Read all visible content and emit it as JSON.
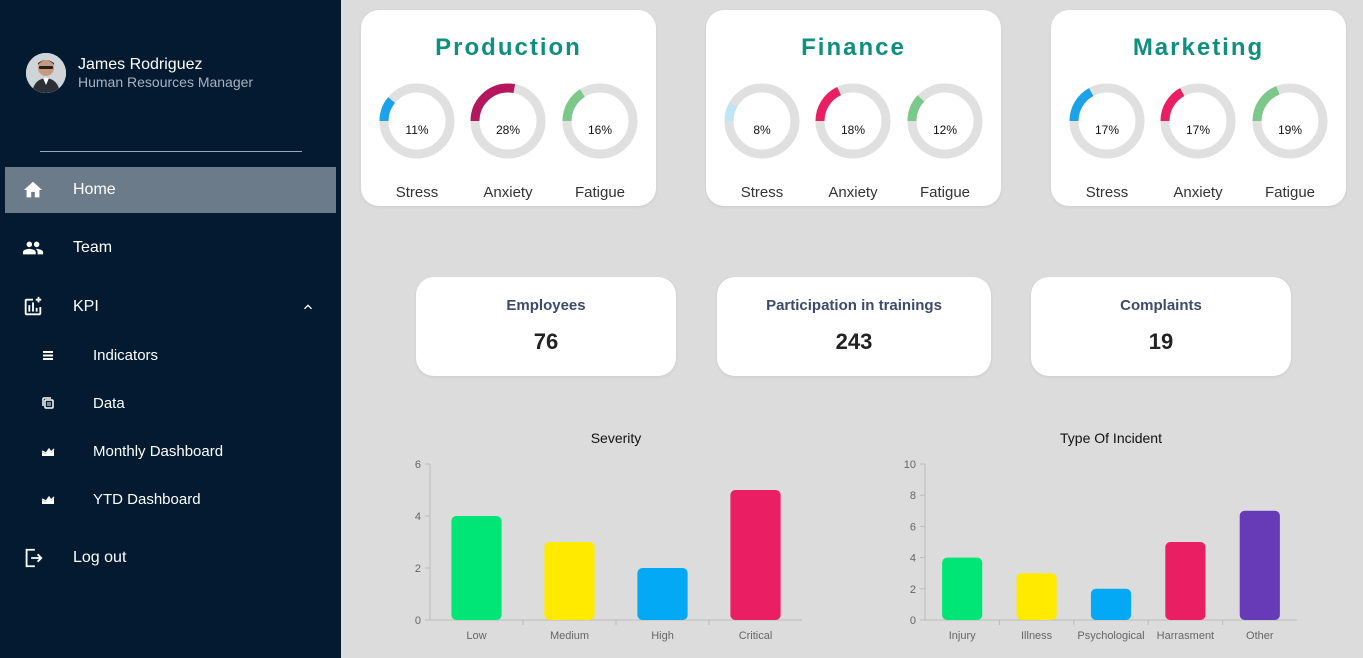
{
  "user": {
    "name": "James Rodriguez",
    "role": "Human Resources Manager"
  },
  "nav": {
    "home": "Home",
    "team": "Team",
    "kpi": "KPI",
    "indicators": "Indicators",
    "data": "Data",
    "monthly": "Monthly Dashboard",
    "ytd": "YTD Dashboard",
    "logout": "Log out"
  },
  "departments": [
    {
      "title": "Production",
      "metrics": [
        {
          "label": "Stress",
          "percent": 11,
          "display": "11%",
          "color": "#1aa3e8"
        },
        {
          "label": "Anxiety",
          "percent": 28,
          "display": "28%",
          "color": "#b5175e"
        },
        {
          "label": "Fatigue",
          "percent": 16,
          "display": "16%",
          "color": "#7cc78a"
        }
      ]
    },
    {
      "title": "Finance",
      "metrics": [
        {
          "label": "Stress",
          "percent": 8,
          "display": "8%",
          "color": "#bfe6f7"
        },
        {
          "label": "Anxiety",
          "percent": 18,
          "display": "18%",
          "color": "#e91e63"
        },
        {
          "label": "Fatigue",
          "percent": 12,
          "display": "12%",
          "color": "#7cc78a"
        }
      ]
    },
    {
      "title": "Marketing",
      "metrics": [
        {
          "label": "Stress",
          "percent": 17,
          "display": "17%",
          "color": "#1aa3e8"
        },
        {
          "label": "Anxiety",
          "percent": 17,
          "display": "17%",
          "color": "#e91e63"
        },
        {
          "label": "Fatigue",
          "percent": 19,
          "display": "19%",
          "color": "#7cc78a"
        }
      ]
    }
  ],
  "stats": [
    {
      "label": "Employees",
      "value": "76"
    },
    {
      "label": "Participation in trainings",
      "value": "243"
    },
    {
      "label": "Complaints",
      "value": "19"
    }
  ],
  "chart_data": [
    {
      "type": "bar",
      "title": "Severity",
      "categories": [
        "Low",
        "Medium",
        "High",
        "Critical"
      ],
      "values": [
        4,
        3,
        2,
        5
      ],
      "colors": [
        "#00e676",
        "#ffea00",
        "#03a9f4",
        "#e91e63"
      ],
      "ylim": [
        0,
        6
      ],
      "yticks": [
        0,
        2,
        4,
        6
      ],
      "grid": false
    },
    {
      "type": "bar",
      "title": "Type Of Incident",
      "categories": [
        "Injury",
        "Illness",
        "Psychological",
        "Harrasment",
        "Other"
      ],
      "values": [
        4,
        3,
        2,
        5,
        7
      ],
      "colors": [
        "#00e676",
        "#ffea00",
        "#03a9f4",
        "#e91e63",
        "#673ab7"
      ],
      "ylim": [
        0,
        10
      ],
      "yticks": [
        0,
        2,
        4,
        6,
        8,
        10
      ],
      "grid": false
    }
  ]
}
